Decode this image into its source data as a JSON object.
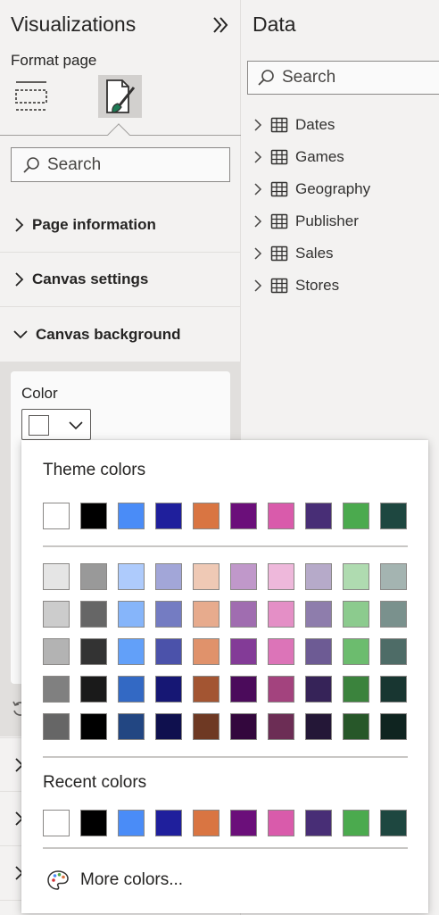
{
  "visualizations": {
    "title": "Visualizations",
    "subtitle": "Format page",
    "search_placeholder": "Search",
    "sections": [
      {
        "label": "Page information",
        "expanded": false
      },
      {
        "label": "Canvas settings",
        "expanded": false
      },
      {
        "label": "Canvas background",
        "expanded": true
      }
    ],
    "color_label": "Color",
    "selected_color": "#FFFFFF"
  },
  "data_pane": {
    "title": "Data",
    "search_placeholder": "Search",
    "tables": [
      "Dates",
      "Games",
      "Geography",
      "Publisher",
      "Sales",
      "Stores"
    ]
  },
  "color_popup": {
    "theme_title": "Theme colors",
    "recent_title": "Recent colors",
    "more_colors_label": "More colors...",
    "theme_colors": [
      "#FFFFFF",
      "#000000",
      "#4A8CF7",
      "#1F1F9C",
      "#D97542",
      "#6B0F7A",
      "#D95BAB",
      "#482E76",
      "#4BAA4E",
      "#1E4740"
    ],
    "shades": [
      [
        "#E5E5E5",
        "#999999",
        "#AECBFC",
        "#A2A6D8",
        "#EFC9B5",
        "#C098CA",
        "#EEB8DB",
        "#B6AAC9",
        "#AFDBB0",
        "#A4B4B1"
      ],
      [
        "#CCCCCC",
        "#666666",
        "#86B5FA",
        "#747CC2",
        "#E7AB8D",
        "#A06DB0",
        "#E48FC6",
        "#8E7DAC",
        "#8CCB8E",
        "#7A918D"
      ],
      [
        "#B3B3B3",
        "#333333",
        "#62A0F9",
        "#4B52AA",
        "#E0926B",
        "#833B97",
        "#DC74B8",
        "#6D5B94",
        "#6CBC6E",
        "#4E6C67"
      ],
      [
        "#808080",
        "#1A1A1A",
        "#3369C4",
        "#161774",
        "#A35532",
        "#4B0B5B",
        "#A3437E",
        "#362358",
        "#3B833D",
        "#183631"
      ],
      [
        "#666666",
        "#000000",
        "#224682",
        "#0F104E",
        "#6E3923",
        "#33073D",
        "#6C2D55",
        "#241737",
        "#275729",
        "#0F2420"
      ]
    ],
    "recent_colors": [
      "#FFFFFF",
      "#000000",
      "#4A8CF7",
      "#1F1F9C",
      "#D97542",
      "#6B0F7A",
      "#D95BAB",
      "#482E76",
      "#4BAA4E",
      "#1E4740"
    ]
  }
}
